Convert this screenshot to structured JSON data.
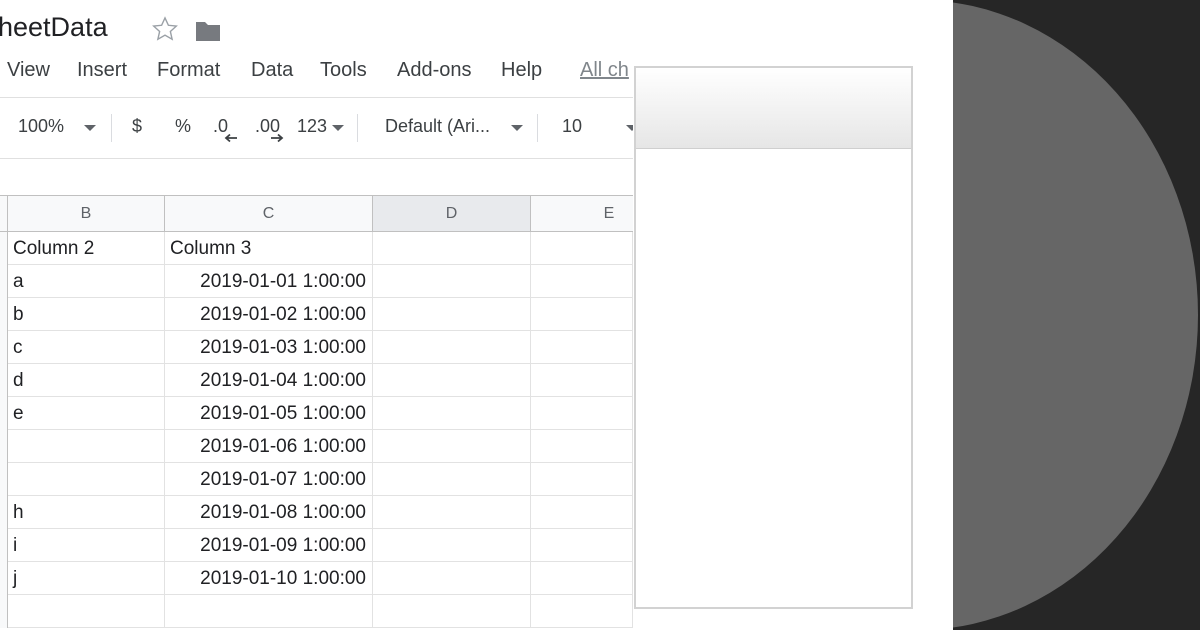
{
  "document": {
    "title": "heetData"
  },
  "menu": {
    "items": [
      "View",
      "Insert",
      "Format",
      "Data",
      "Tools",
      "Add-ons",
      "Help"
    ],
    "changes_link": "All ch"
  },
  "toolbar": {
    "zoom": "100%",
    "currency": "$",
    "percent": "%",
    "decrease_decimal": ".0",
    "increase_decimal": ".00",
    "number_format": "123",
    "font": "Default (Ari...",
    "font_size": "10"
  },
  "grid": {
    "columns": [
      "B",
      "C",
      "D",
      "E"
    ],
    "selected_column": "D",
    "rows": [
      {
        "b": "Column 2",
        "c": "Column 3"
      },
      {
        "b": "a",
        "c": "2019-01-01 1:00:00"
      },
      {
        "b": "b",
        "c": "2019-01-02 1:00:00"
      },
      {
        "b": "c",
        "c": "2019-01-03 1:00:00"
      },
      {
        "b": "d",
        "c": "2019-01-04 1:00:00"
      },
      {
        "b": "e",
        "c": "2019-01-05 1:00:00"
      },
      {
        "b": "",
        "c": "2019-01-06 1:00:00"
      },
      {
        "b": "",
        "c": "2019-01-07 1:00:00"
      },
      {
        "b": "h",
        "c": "2019-01-08 1:00:00"
      },
      {
        "b": "i",
        "c": "2019-01-09 1:00:00"
      },
      {
        "b": "j",
        "c": "2019-01-10 1:00:00"
      },
      {
        "b": "",
        "c": ""
      }
    ]
  },
  "colors": {
    "background_dark": "#262626",
    "disc": "#666666",
    "selected_header": "#e8eaed"
  }
}
